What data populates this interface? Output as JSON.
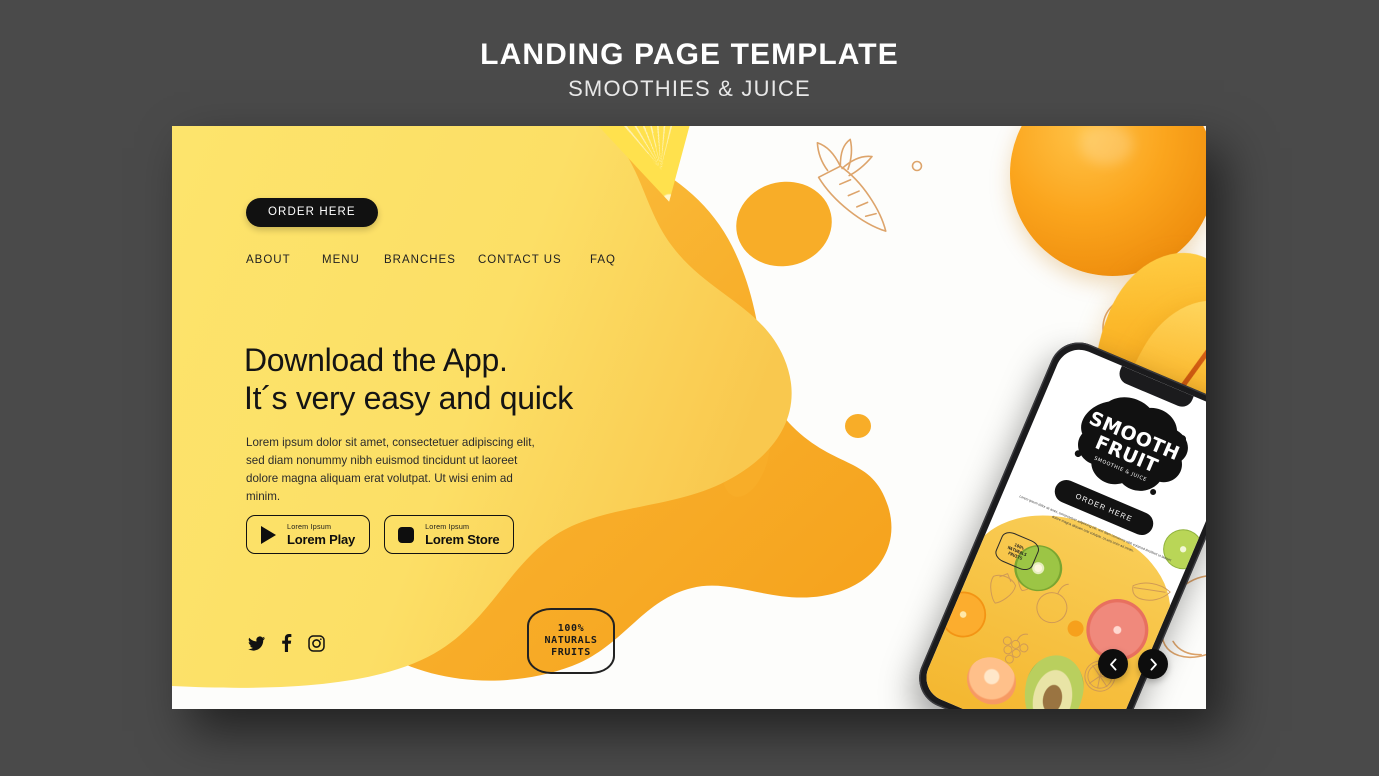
{
  "header": {
    "title": "LANDING PAGE TEMPLATE",
    "subtitle": "SMOOTHIES & JUICE"
  },
  "colors": {
    "background": "#4a4a4a",
    "panel_yellow": "#fde46c",
    "splash_orange": "#f6a623",
    "dark": "#111111",
    "white": "#ffffff",
    "doodle_line": "#dda46b"
  },
  "landing": {
    "order_button": "ORDER HERE",
    "nav": [
      {
        "label": "ABOUT"
      },
      {
        "label": "MENU"
      },
      {
        "label": "BRANCHES"
      },
      {
        "label": "CONTACT US"
      },
      {
        "label": "FAQ"
      }
    ],
    "headline_line1": "Download the App.",
    "headline_line2": "It´s very easy and quick",
    "paragraph": "Lorem ipsum dolor sit amet, consectetuer adipiscing elit, sed diam nonummy nibh euismod tincidunt ut laoreet dolore magna aliquam erat volutpat. Ut wisi enim ad minim.",
    "store_buttons": [
      {
        "icon": "play-triangle-icon",
        "small": "Lorem Ipsum",
        "big": "Lorem Play"
      },
      {
        "icon": "app-square-icon",
        "small": "Lorem Ipsum",
        "big": "Lorem Store"
      }
    ],
    "socials": [
      {
        "icon": "twitter-icon",
        "name": "twitter"
      },
      {
        "icon": "facebook-icon",
        "name": "facebook"
      },
      {
        "icon": "instagram-icon",
        "name": "instagram"
      }
    ],
    "badge": {
      "line1": "100%",
      "line2": "NATURALS",
      "line3": "FRUITS"
    },
    "carousel": {
      "prev_icon": "chevron-left-icon",
      "next_icon": "chevron-right-icon"
    }
  },
  "phone": {
    "logo_line1": "SMOOTH",
    "logo_line2": "FRUIT",
    "logo_sub": "SMOOTHIE & JUICE",
    "order_button": "ORDER HERE",
    "paragraph": "Lorem ipsum dolor sit amet, consectetuer adipiscing elit, sed diam nonummy nibh euismod tincidunt ut laoreet dolore magna aliquam erat volutpat. Ut wisi enim ad minim.",
    "badge": {
      "line1": "100%",
      "line2": "NATURALS",
      "line3": "FRUITS"
    }
  }
}
